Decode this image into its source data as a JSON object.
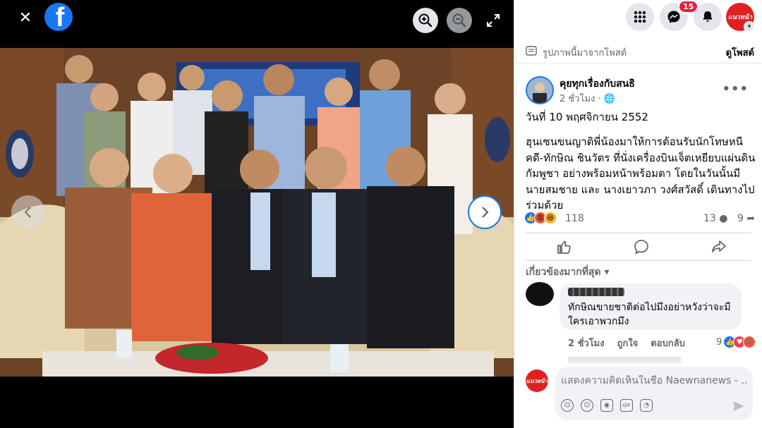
{
  "viewer": {
    "close_icon": "close-icon",
    "logo_icon": "facebook-logo",
    "logo_glyph": "f",
    "zoom_in_icon": "zoom-in-icon",
    "zoom_out_icon": "zoom-out-icon",
    "fullscreen_icon": "fullscreen-icon",
    "prev_icon": "chevron-left-icon",
    "next_icon": "chevron-right-icon"
  },
  "topbar": {
    "menu_icon": "grid-menu-icon",
    "messenger_icon": "messenger-icon",
    "messenger_badge": "15",
    "notification_icon": "bell-icon",
    "profile_logo": "แนวหน้า"
  },
  "from_post": {
    "text": "รูปภาพนี้มาจากโพสต์",
    "view_label": "ดูโพสต์"
  },
  "post": {
    "page_name": "คุยทุกเรื่องกับสนธิ",
    "time": "2 ชั่วโมง · 🌐",
    "date_line": "วันที่ 10 พฤศจิกายน 2552",
    "body": "ฮุนเซนขนญาติพี่น้องมาให้การต้อนรับนักโทษหนีคดี-ทักษิณ ชินวัตร ที่นั่งเครื่องบินเจ็ตเหยียบแผ่นดินกัมพูชา อย่างพร้อมหน้าพร้อมตา โดยในวันนั้นมีนายสมชาย และ นางเยาวภา วงศ์สวัสดิ์ เดินทางไปร่วมด้วย",
    "reaction_count": "118",
    "comment_count": "13",
    "share_count": "9"
  },
  "comments": {
    "filter_label": "เกี่ยวข้องมากที่สุด ▾",
    "items": [
      {
        "text": "ทักษิณขายชาติต่อไปมึงอย่าหวังว่าจะมีใครเอาพวกมึง",
        "time": "2 ชั่วโมง",
        "like_label": "ถูกใจ",
        "reply_label": "ตอบกลับ",
        "reaction_count": "9"
      }
    ]
  },
  "composer": {
    "placeholder": "แสดงความคิดเห็นในชื่อ Naewnanews - ...",
    "avatar_logo": "แนวหน้า"
  },
  "colors": {
    "facebook_blue": "#1877f2",
    "brand_red": "#e02020",
    "secondary_text": "#65676b"
  }
}
